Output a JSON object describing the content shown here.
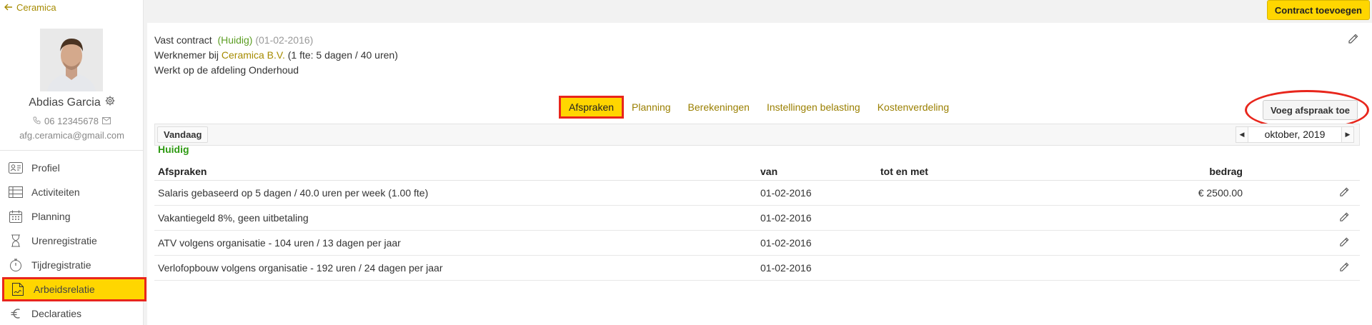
{
  "sidebar": {
    "back_label": "Ceramica",
    "user_name": "Abdias Garcia",
    "phone": "06 12345678",
    "email": "afg.ceramica@gmail.com",
    "items": [
      {
        "label": "Profiel",
        "icon": "id-card-icon"
      },
      {
        "label": "Activiteiten",
        "icon": "table-icon"
      },
      {
        "label": "Planning",
        "icon": "calendar-icon"
      },
      {
        "label": "Urenregistratie",
        "icon": "hourglass-icon"
      },
      {
        "label": "Tijdregistratie",
        "icon": "stopwatch-icon"
      },
      {
        "label": "Arbeidsrelatie",
        "icon": "contract-icon",
        "active": true
      },
      {
        "label": "Declaraties",
        "icon": "euro-icon"
      }
    ]
  },
  "header": {
    "add_contract_label": "Contract toevoegen"
  },
  "contract": {
    "type": "Vast contract",
    "status": "(Huidig)",
    "start": "(01-02-2016)",
    "line2_prefix": "Werknemer bij",
    "employer": "Ceramica B.V.",
    "line2_suffix": "(1 fte: 5 dagen / 40 uren)",
    "department_line": "Werkt op de afdeling Onderhoud"
  },
  "tabs": [
    {
      "label": "Afspraken",
      "active": true
    },
    {
      "label": "Planning"
    },
    {
      "label": "Berekeningen"
    },
    {
      "label": "Instellingen belasting"
    },
    {
      "label": "Kostenverdeling"
    }
  ],
  "actions": {
    "add_appointment_label": "Voeg afspraak toe",
    "today_label": "Vandaag",
    "month_label": "oktober, 2019"
  },
  "table": {
    "section_label": "Huidig",
    "headers": {
      "description": "Afspraken",
      "from": "van",
      "to": "tot en met",
      "amount": "bedrag"
    },
    "rows": [
      {
        "description": "Salaris gebaseerd op 5 dagen / 40.0 uren per week (1.00 fte)",
        "from": "01-02-2016",
        "to": "",
        "amount": "€ 2500.00"
      },
      {
        "description": "Vakantiegeld 8%, geen uitbetaling",
        "from": "01-02-2016",
        "to": "",
        "amount": ""
      },
      {
        "description": "ATV volgens organisatie - 104 uren / 13 dagen per jaar",
        "from": "01-02-2016",
        "to": "",
        "amount": ""
      },
      {
        "description": "Verlofopbouw volgens organisatie - 192 uren / 24 dagen per jaar",
        "from": "01-02-2016",
        "to": "",
        "amount": ""
      }
    ]
  },
  "colors": {
    "accent_yellow": "#ffd600",
    "highlight_red": "#e8261c",
    "status_green": "#2e9a12",
    "link_gold": "#a68b00"
  }
}
